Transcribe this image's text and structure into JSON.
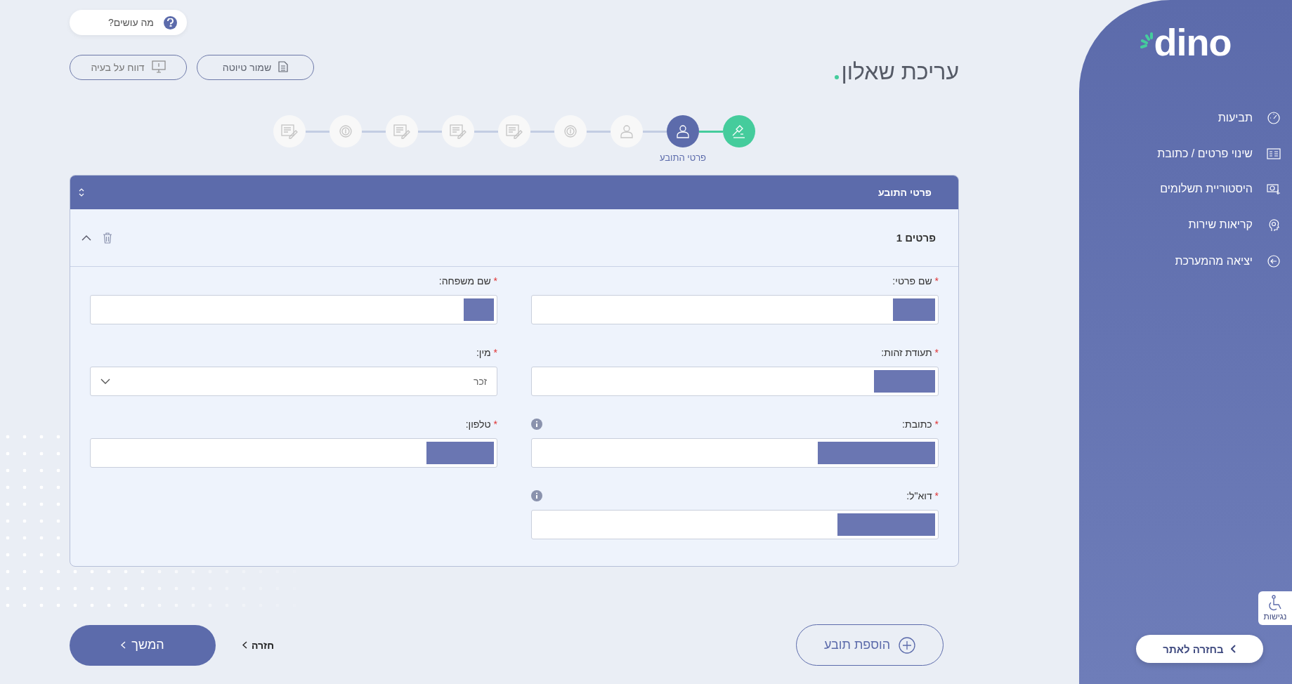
{
  "sidebar": {
    "logo": "dino",
    "menu": [
      {
        "label": "תביעות"
      },
      {
        "label": "שינוי פרטים / כתובת"
      },
      {
        "label": "היסטוריית תשלומים"
      },
      {
        "label": "קריאות שירות"
      },
      {
        "label": "יציאה מהמערכת"
      }
    ],
    "back_button": "בחזרה לאתר",
    "accessibility": "נגישות"
  },
  "help_button": "מה עושים?",
  "page_title": "עריכת שאלון",
  "toolbar": [
    {
      "label": "שמור טיוטה"
    },
    {
      "label": "דווח על בעיה"
    }
  ],
  "steps": [
    {
      "completed": true,
      "selected": false
    },
    {
      "completed": false,
      "selected": true,
      "label": "פרטי התובע"
    },
    {
      "completed": false,
      "selected": false
    },
    {
      "completed": false,
      "selected": false
    },
    {
      "completed": false,
      "selected": false
    },
    {
      "completed": false,
      "selected": false
    },
    {
      "completed": false,
      "selected": false
    },
    {
      "completed": false,
      "selected": false
    },
    {
      "completed": false,
      "selected": false
    }
  ],
  "panel": {
    "title": "פרטי התובע",
    "section": {
      "title": "פרטים 1",
      "expanded": true,
      "fields": [
        {
          "label": "שם פרטי:",
          "required_mark": "*",
          "kind": "text",
          "redacted": true
        },
        {
          "label": "שם משפחה:",
          "required_mark": "*",
          "kind": "text",
          "redacted": true
        },
        {
          "label": "תעודת זהות:",
          "required_mark": "*",
          "kind": "text",
          "redacted": true
        },
        {
          "label": "מין:",
          "required_mark": "*",
          "kind": "select",
          "value": "זכר"
        },
        {
          "label": "כתובת:",
          "required_mark": "*",
          "kind": "text",
          "redacted": true,
          "info": true
        },
        {
          "label": "טלפון:",
          "required_mark": "*",
          "kind": "text",
          "redacted": true
        },
        {
          "label": "דוא\"ל:",
          "required_mark": "*",
          "kind": "text",
          "redacted": true,
          "info": true
        }
      ]
    }
  },
  "footer": {
    "add_button": "הוספת תובע",
    "back": "חזרה",
    "next": "המשך"
  }
}
